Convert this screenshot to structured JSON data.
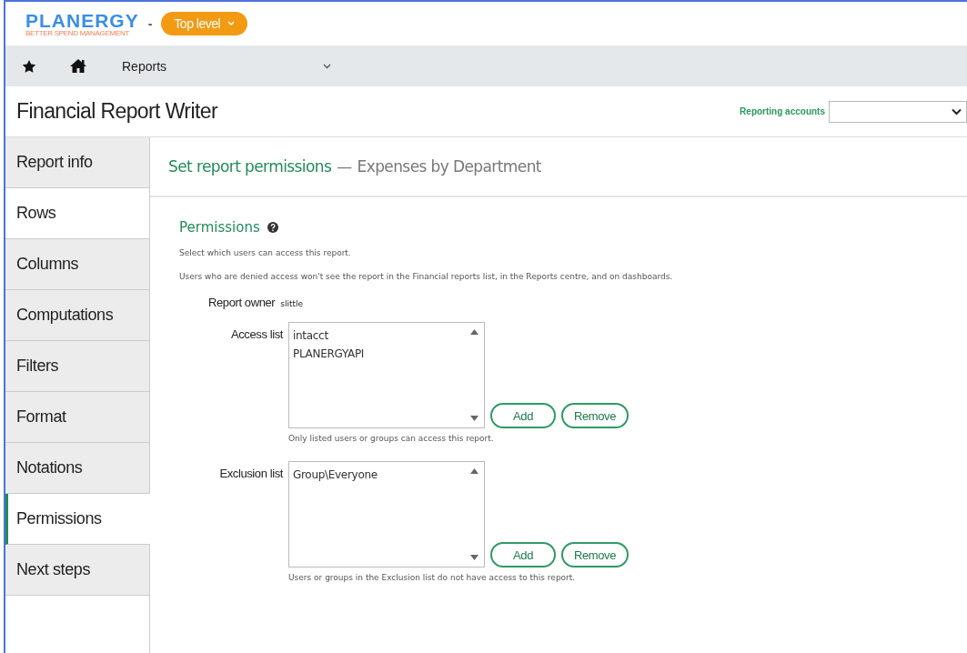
{
  "logo": {
    "name": "PLANERGY",
    "tagline": "BETTER SPEND MANAGEMENT"
  },
  "level_selector": {
    "separator": "-",
    "label": "Top level"
  },
  "nav": {
    "menu": "Reports"
  },
  "page_title": "Financial Report Writer",
  "reporting_accounts": {
    "label": "Reporting accounts"
  },
  "sidebar": {
    "items": [
      {
        "label": "Report info",
        "selected": false
      },
      {
        "label": "Rows",
        "selected": false,
        "hovered": true
      },
      {
        "label": "Columns",
        "selected": false
      },
      {
        "label": "Computations",
        "selected": false
      },
      {
        "label": "Filters",
        "selected": false
      },
      {
        "label": "Format",
        "selected": false
      },
      {
        "label": "Notations",
        "selected": false
      },
      {
        "label": "Permissions",
        "selected": true
      },
      {
        "label": "Next steps",
        "selected": false
      }
    ]
  },
  "content": {
    "heading": "Set report permissions",
    "separator": "—",
    "subheading": "Expenses by Department",
    "section_title": "Permissions",
    "paragraphs": [
      "Select which users can access this report.",
      "Users who are denied access won't see the report in the Financial reports list, in the Reports centre, and on dashboards."
    ],
    "owner": {
      "label": "Report owner",
      "value": "slittle"
    },
    "lists": [
      {
        "label": "Access list",
        "items": [
          "intacct",
          "PLANERGYAPI"
        ],
        "buttons": [
          "Add",
          "Remove"
        ],
        "help": "Only listed users or groups can access this report."
      },
      {
        "label": "Exclusion list",
        "items": [
          "Group\\Everyone"
        ],
        "buttons": [
          "Add",
          "Remove"
        ],
        "help": "Users or groups in the Exclusion list do not have access to this report."
      }
    ]
  }
}
